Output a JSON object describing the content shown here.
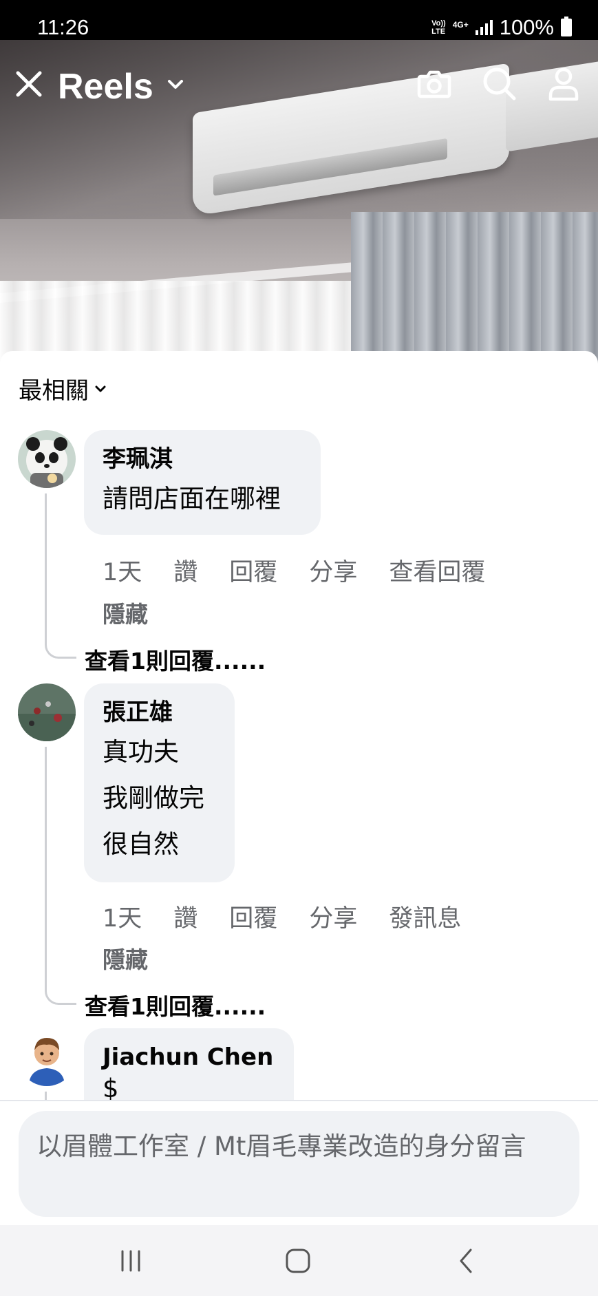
{
  "status": {
    "time": "11:26",
    "volte_top": "Vo))",
    "volte_bottom": "LTE",
    "network": "4G+",
    "battery": "100%"
  },
  "header": {
    "title": "Reels",
    "icons": [
      "close-icon",
      "chevron-down-icon",
      "camera-icon",
      "search-icon",
      "profile-icon"
    ]
  },
  "sheet": {
    "sort_label": "最相關",
    "comments": [
      {
        "author": "李珮淇",
        "lines": [
          "請問店面在哪裡"
        ],
        "actions": [
          "1天",
          "讚",
          "回覆",
          "分享",
          "查看回覆"
        ],
        "hide": "隱藏",
        "view_replies": "查看1則回覆......"
      },
      {
        "author": "張正雄",
        "lines": [
          "真功夫",
          "我剛做完",
          "很自然"
        ],
        "actions": [
          "1天",
          "讚",
          "回覆",
          "分享",
          "發訊息"
        ],
        "hide": "隱藏",
        "view_replies": "查看1則回覆......"
      },
      {
        "author": "Jiachun Chen",
        "lines": [
          "$"
        ]
      }
    ]
  },
  "composer": {
    "placeholder": "以眉體工作室 / Mt眉毛專業改造的身分留言"
  },
  "navbar": {
    "icons": [
      "recent-apps-icon",
      "home-icon",
      "back-icon"
    ]
  }
}
